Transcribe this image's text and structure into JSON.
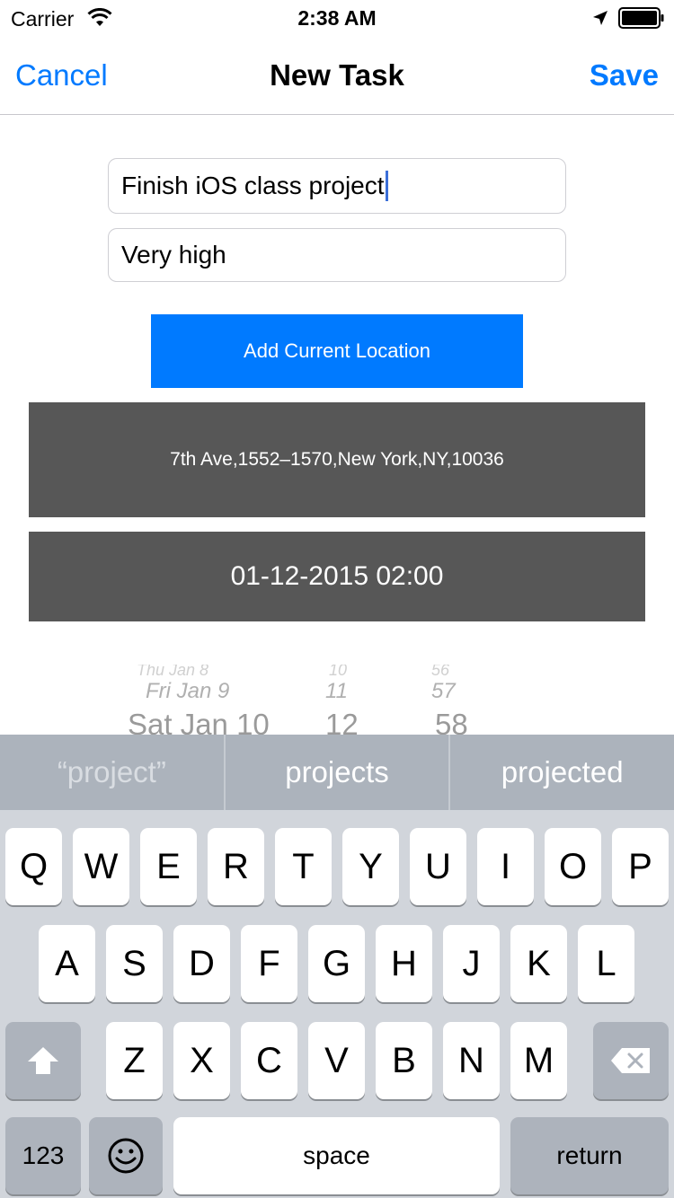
{
  "status_bar": {
    "carrier": "Carrier",
    "time": "2:38 AM",
    "wifi_icon": "wifi-icon",
    "location_icon": "location-arrow-icon",
    "battery_icon": "battery-icon"
  },
  "nav": {
    "cancel": "Cancel",
    "title": "New Task",
    "save": "Save",
    "accent_color": "#007aff"
  },
  "form": {
    "task_name": "Finish iOS class project",
    "priority": "Very high",
    "add_location_label": "Add Current Location",
    "location": "7th Ave,1552–1570,New York,NY,10036",
    "datetime": "01-12-2015 02:00"
  },
  "picker": {
    "faint_row": {
      "day": "Thu Jan 8",
      "hour": "10",
      "minute": "56"
    },
    "mid_row": {
      "day": "Fri Jan 9",
      "hour": "11",
      "minute": "57"
    },
    "near_row": {
      "day": "Sat Jan 10",
      "hour": "12",
      "minute": "58"
    }
  },
  "suggestions": [
    "“project”",
    "projects",
    "projected"
  ],
  "keyboard": {
    "row1": [
      "Q",
      "W",
      "E",
      "R",
      "T",
      "Y",
      "U",
      "I",
      "O",
      "P"
    ],
    "row2": [
      "A",
      "S",
      "D",
      "F",
      "G",
      "H",
      "J",
      "K",
      "L"
    ],
    "row3": [
      "Z",
      "X",
      "C",
      "V",
      "B",
      "N",
      "M"
    ],
    "shift_icon": "shift-arrow-icon",
    "delete_icon": "backspace-icon",
    "emoji_icon": "emoji-face-icon",
    "numbers": "123",
    "space": "space",
    "return": "return"
  }
}
